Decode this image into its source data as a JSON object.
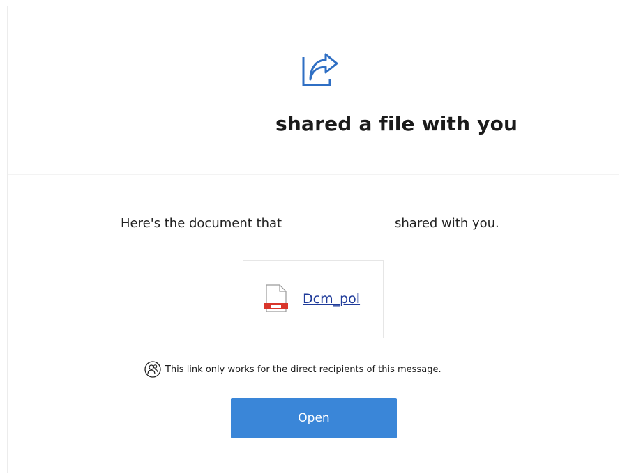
{
  "header": {
    "icon": "share-icon",
    "title": "shared a file with you"
  },
  "message": {
    "prefix": "Here's the document that",
    "suffix": "shared with you."
  },
  "file": {
    "icon": "pdf-file-icon",
    "name": "Dcm_pol"
  },
  "notice": {
    "icon": "people-icon",
    "text": "This link only works for the direct recipients of this message."
  },
  "actions": {
    "open_label": "Open"
  },
  "colors": {
    "accent": "#3a86d8",
    "icon_blue": "#2f6fc4",
    "link": "#1f3b9a",
    "pdf_red": "#d9362b"
  }
}
